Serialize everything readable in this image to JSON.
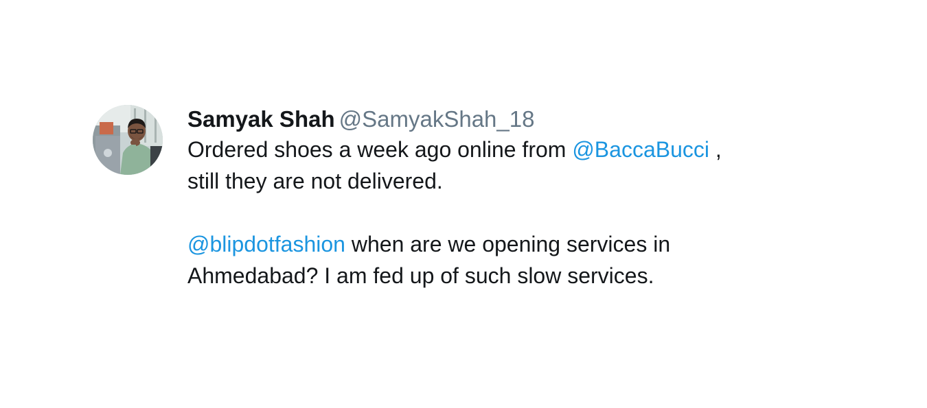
{
  "tweet": {
    "display_name": "Samyak Shah",
    "handle": "@SamyakShah_18",
    "paragraph1": {
      "text_before": "Ordered shoes a week ago online from ",
      "mention": "@BaccaBucci",
      "text_after_line1": " ,",
      "text_line2": "still they are not delivered."
    },
    "paragraph2": {
      "mention": "@blipdotfashion",
      "text_after_line1": " when are we opening services in",
      "text_line2": "Ahmedabad? I am fed up of such slow services."
    }
  },
  "colors": {
    "text": "#14171a",
    "handle": "#657786",
    "mention": "#1b95e0",
    "background": "#ffffff"
  },
  "icons": {
    "avatar": "profile-photo"
  }
}
